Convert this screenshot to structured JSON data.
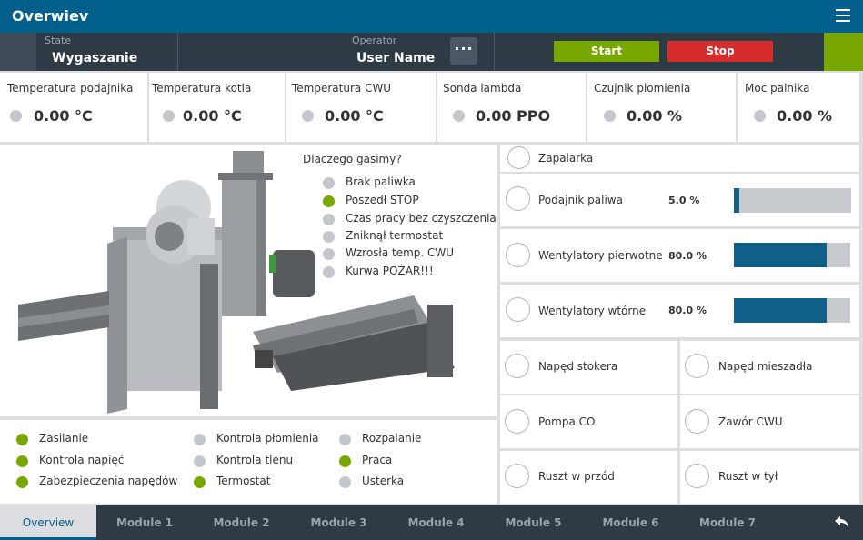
{
  "header": {
    "title": "Overwiev",
    "menu_icon": "hamburger-icon"
  },
  "status_bar": {
    "state_label": "State",
    "state_value": "Wygaszanie",
    "operator_label": "Operator",
    "operator_value": "User Name",
    "more_label": "···",
    "start_label": "Start",
    "stop_label": "Stop",
    "colors": {
      "start": "#78a800",
      "stop": "#d52b2b"
    }
  },
  "sensors": [
    {
      "label": "Temperatura podajnika",
      "value": "0.00 °C"
    },
    {
      "label": "Temperatura kotla",
      "value": "0.00 °C"
    },
    {
      "label": "Temperatura CWU",
      "value": "0.00 °C"
    },
    {
      "label": "Sonda lambda",
      "value": "0.00 PPO"
    },
    {
      "label": "Czujnik plomienia",
      "value": "0.00 %"
    },
    {
      "label": "Moc palnika",
      "value": "0.00 %"
    }
  ],
  "reasons": {
    "title": "Dlaczego gasimy?",
    "items": [
      {
        "label": "Brak paliwka",
        "status": "off"
      },
      {
        "label": "Poszedł STOP",
        "status": "on"
      },
      {
        "label": "Czas pracy bez czyszczenia",
        "status": "off"
      },
      {
        "label": "Zniknął termostat",
        "status": "off"
      },
      {
        "label": "Wzrosła temp. CWU",
        "status": "off"
      },
      {
        "label": "Kurwa POŻAR!!!",
        "status": "off"
      }
    ]
  },
  "status_indicators": [
    {
      "label": "Zasilanie",
      "status": "on"
    },
    {
      "label": "Kontrola napięć",
      "status": "on"
    },
    {
      "label": "Zabezpieczenia napędów",
      "status": "on"
    },
    {
      "label": "Kontrola płomienia",
      "status": "off"
    },
    {
      "label": "Kontrola tlenu",
      "status": "off"
    },
    {
      "label": "Termostat",
      "status": "on"
    },
    {
      "label": "Rozpalanie",
      "status": "off"
    },
    {
      "label": "Praca",
      "status": "on"
    },
    {
      "label": "Usterka",
      "status": "off"
    }
  ],
  "controls": {
    "zapalarka": "Zapalarka",
    "podajnik": {
      "label": "Podajnik paliwa",
      "value_text": "5.0 %",
      "value": 5.0
    },
    "went_pierwotne": {
      "label": "Wentylatory pierwotne",
      "value_text": "80.0 %",
      "value": 80.0
    },
    "went_wtorne": {
      "label": "Wentylatory wtórne",
      "value_text": "80.0 %",
      "value": 80.0
    },
    "naped_stokera": "Napęd stokera",
    "naped_mieszadla": "Napęd mieszadła",
    "pompa_co": "Pompa CO",
    "zawor_cwu": "Zawór CWU",
    "ruszt_przod": "Ruszt w przód",
    "ruszt_tyl": "Ruszt w tył"
  },
  "colors": {
    "indicator_on": "#78a800",
    "indicator_off": "#c4c8cc",
    "accent": "#005f8b",
    "bar_fill": "#0f5f88"
  },
  "tabs": [
    {
      "label": "Overview"
    },
    {
      "label": "Module 1"
    },
    {
      "label": "Module 2"
    },
    {
      "label": "Module 3"
    },
    {
      "label": "Module 4"
    },
    {
      "label": "Module 5"
    },
    {
      "label": "Module 6"
    },
    {
      "label": "Module 7"
    }
  ],
  "active_tab": "Overview"
}
